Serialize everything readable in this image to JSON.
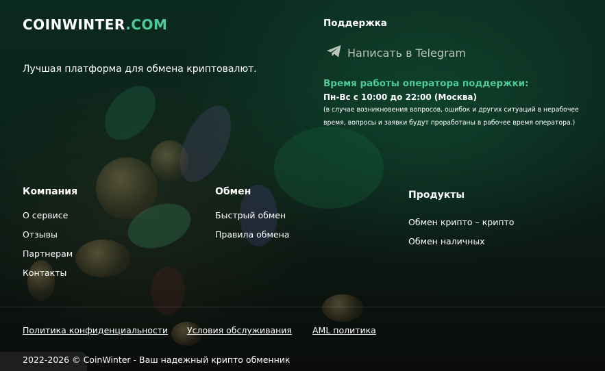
{
  "logo": {
    "brand": "COINWINTER",
    "domain": ".COM"
  },
  "tagline": "Лучшая платформа для обмена криптовалют.",
  "support": {
    "title": "Поддержка",
    "telegram_label": "Написать в Telegram",
    "hours_title": "Время работы оператора поддержки:",
    "hours_main": "Пн-Вс с 10:00 до 22:00 (Москва)",
    "hours_note": "(в случае возникновения вопросов, ошибок и других ситуаций в нерабочее время, вопросы и заявки будут проработаны в рабочее время оператора.)"
  },
  "columns": {
    "company": {
      "title": "Компания",
      "links": [
        "О сервисе",
        "Отзывы",
        "Партнерам",
        "Контакты"
      ]
    },
    "exchange": {
      "title": "Обмен",
      "links": [
        "Быстрый обмен",
        "Правила обмена"
      ]
    },
    "products": {
      "title": "Продукты",
      "links": [
        "Обмен крипто – крипто",
        "Обмен наличных"
      ]
    }
  },
  "legal": {
    "privacy": "Политика конфиденциальности",
    "terms": "Условия обслуживания",
    "aml": "AML политика"
  },
  "copyright": "2022-2026 © CoinWinter - Ваш надежный крипто обменник",
  "icons": {
    "telegram": "telegram-plane-icon"
  },
  "colors": {
    "accent": "#4ec99a",
    "muted": "#b9c4bd"
  }
}
